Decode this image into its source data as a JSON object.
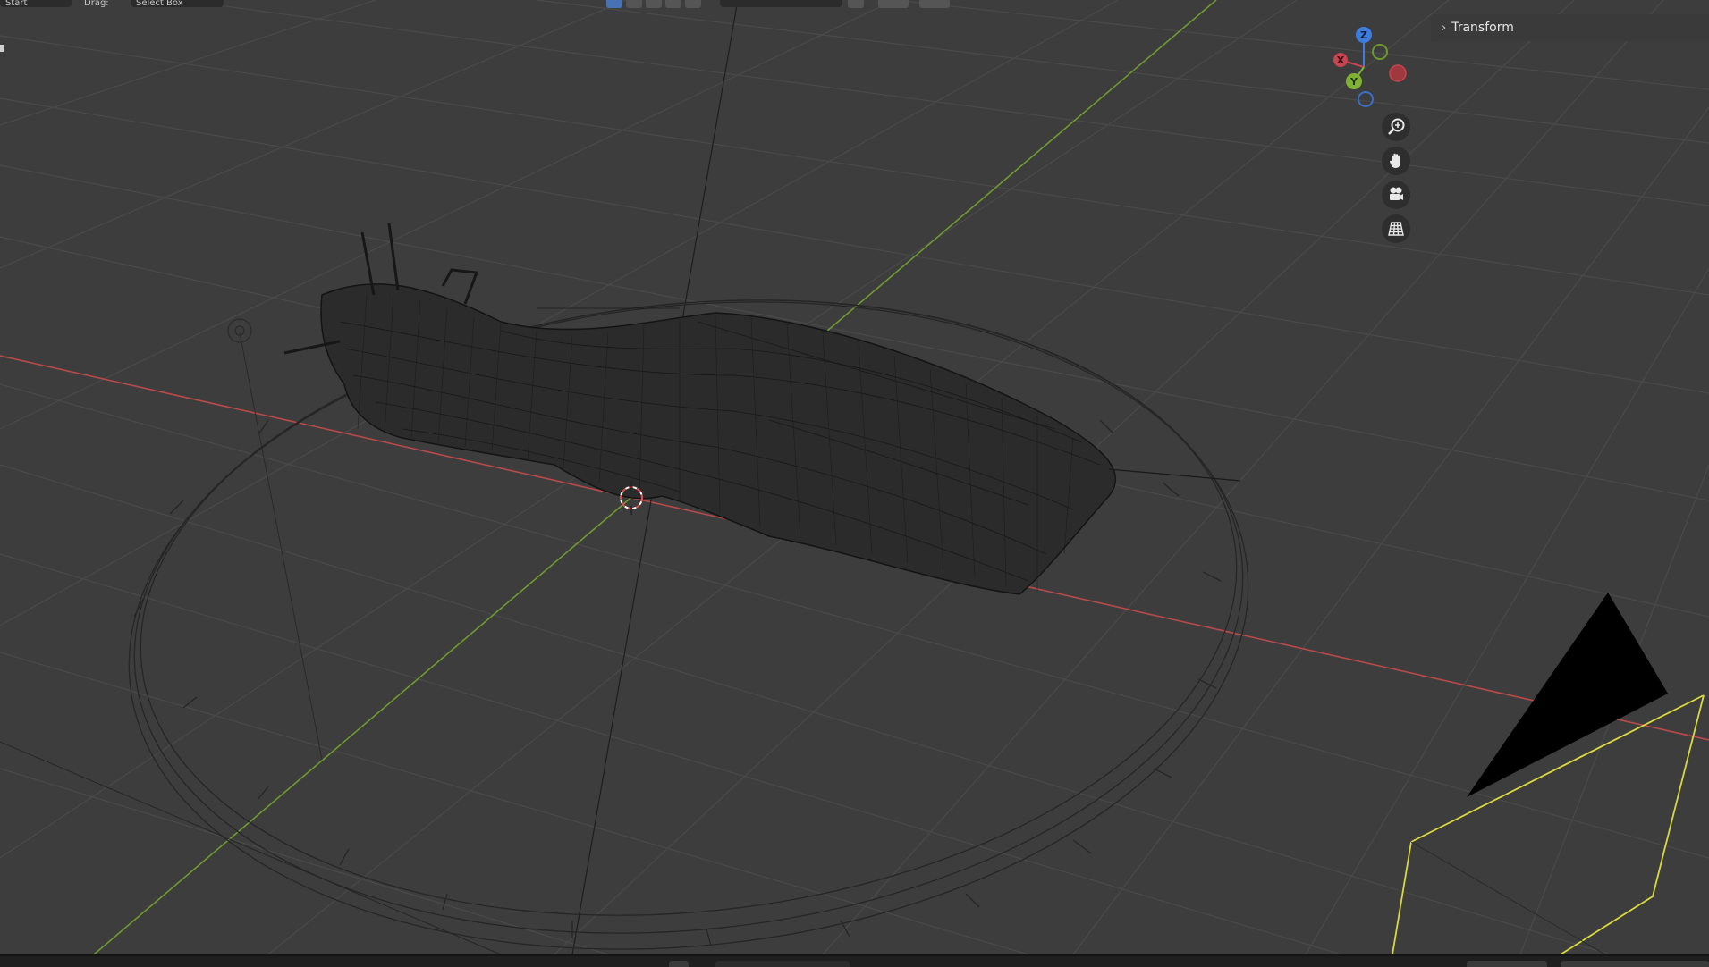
{
  "app": "Blender",
  "header": {
    "mode_label": "Start",
    "drag_label": "Drag:",
    "select_box_label": "Select Box"
  },
  "sidebar": {
    "transform_label": "Transform"
  },
  "gizmo": {
    "x_label": "X",
    "y_label": "Y",
    "z_label": "Z"
  },
  "icons": {
    "zoom": "zoom-icon",
    "pan": "hand-icon",
    "camera": "camera-icon",
    "grid": "grid-icon"
  },
  "colors": {
    "x_axis": "#c94451",
    "y_axis": "#7fb232",
    "z_axis": "#3d7de0",
    "camera_frame": "#e3e34a",
    "viewport_bg": "#3d3d3d"
  }
}
